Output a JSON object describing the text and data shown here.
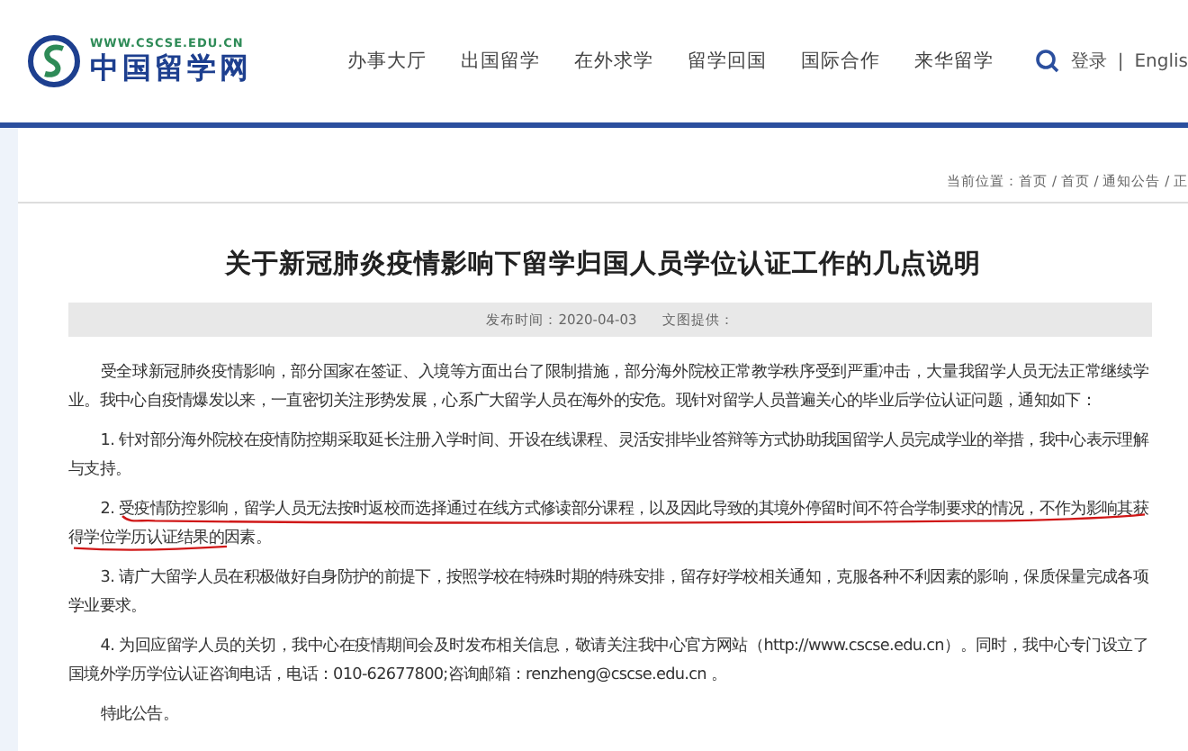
{
  "header": {
    "logo": {
      "url": "WWW.CSCSE.EDU.CN",
      "name": "中国留学网"
    },
    "nav": [
      {
        "label": "办事大厅"
      },
      {
        "label": "出国留学"
      },
      {
        "label": "在外求学"
      },
      {
        "label": "留学回国"
      },
      {
        "label": "国际合作"
      },
      {
        "label": "来华留学"
      }
    ],
    "login": "登录",
    "separator": "|",
    "language": "Englis"
  },
  "breadcrumb": "当前位置：首页 / 首页 / 通知公告 / 正",
  "article": {
    "title": "关于新冠肺炎疫情影响下留学归国人员学位认证工作的几点说明",
    "meta": [
      {
        "text": "发布时间：2020-04-03"
      },
      {
        "text": "文图提供："
      }
    ],
    "paragraphs": [
      {
        "text": "受全球新冠肺炎疫情影响，部分国家在签证、入境等方面出台了限制措施，部分海外院校正常教学秩序受到严重冲击，大量我留学人员无法正常继续学业。我中心自疫情爆发以来，一直密切关注形势发展，心系广大留学人员在海外的安危。现针对留学人员普遍关心的毕业后学位认证问题，通知如下：",
        "annotated": false
      },
      {
        "text": "1. 针对部分海外院校在疫情防控期采取延长注册入学时间、开设在线课程、灵活安排毕业答辩等方式协助我国留学人员完成学业的举措，我中心表示理解与支持。",
        "annotated": false
      },
      {
        "text": "2. 受疫情防控影响，留学人员无法按时返校而选择通过在线方式修读部分课程，以及因此导致的其境外停留时间不符合学制要求的情况，不作为影响其获得学位学历认证结果的因素。",
        "annotated": true
      },
      {
        "text": "3. 请广大留学人员在积极做好自身防护的前提下，按照学校在特殊时期的特殊安排，留存好学校相关通知，克服各种不利因素的影响，保质保量完成各项学业要求。",
        "annotated": false
      },
      {
        "text": "4. 为回应留学人员的关切，我中心在疫情期间会及时发布相关信息，敬请关注我中心官方网站（http://www.cscse.edu.cn）。同时，我中心专门设立了国境外学历学位认证咨询电话，电话：010-62677800;咨询邮箱：renzheng@cscse.edu.cn 。",
        "annotated": false
      },
      {
        "text": "特此公告。",
        "annotated": false
      }
    ]
  }
}
